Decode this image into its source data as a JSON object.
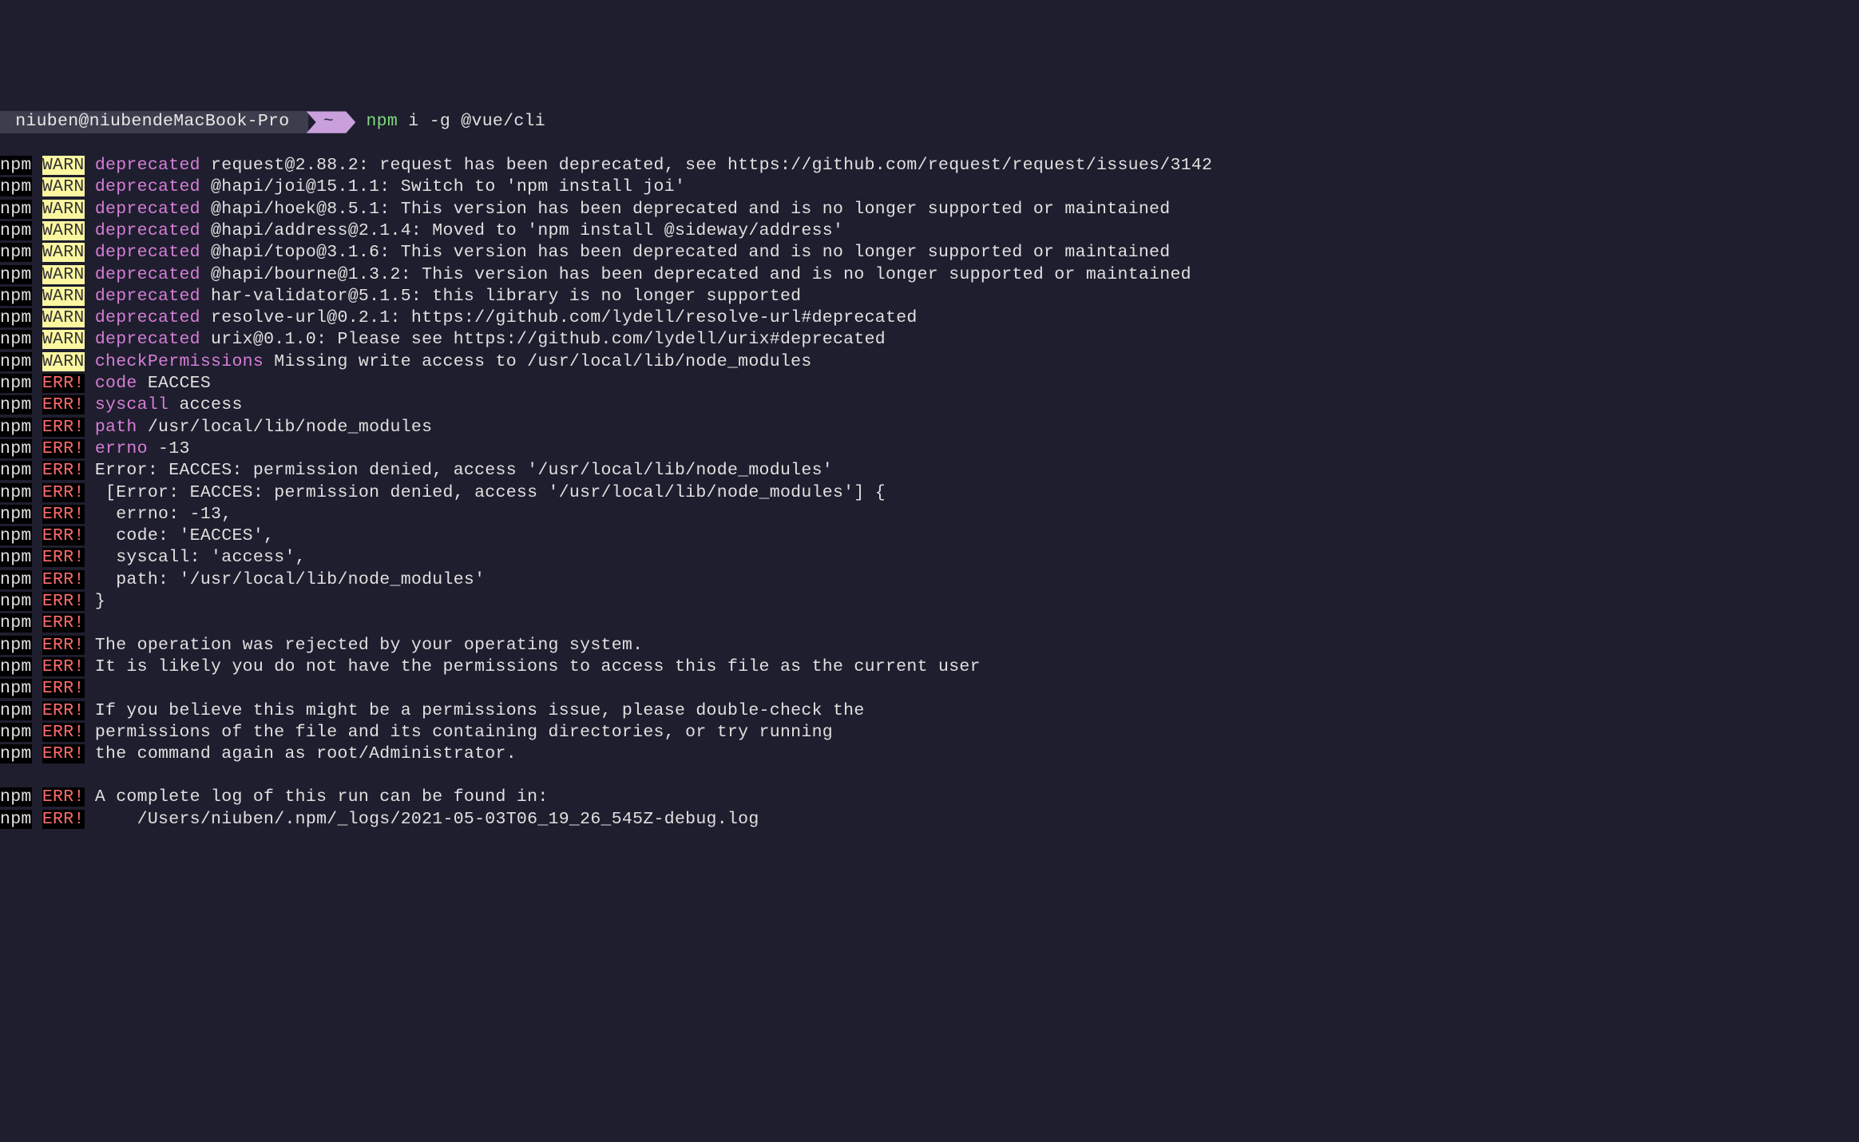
{
  "prompt": {
    "user": " niuben@niubendeMacBook-Pro ",
    "tilde": " ~ ",
    "command_npm": " npm",
    "command_args": " i -g @vue/cli"
  },
  "lines": [
    {
      "type": "warn",
      "kw": "deprecated",
      "rest": " request@2.88.2: request has been deprecated, see https://github.com/request/request/issues/3142"
    },
    {
      "type": "warn",
      "kw": "deprecated",
      "rest": " @hapi/joi@15.1.1: Switch to 'npm install joi'"
    },
    {
      "type": "warn",
      "kw": "deprecated",
      "rest": " @hapi/hoek@8.5.1: This version has been deprecated and is no longer supported or maintained"
    },
    {
      "type": "warn",
      "kw": "deprecated",
      "rest": " @hapi/address@2.1.4: Moved to 'npm install @sideway/address'"
    },
    {
      "type": "warn",
      "kw": "deprecated",
      "rest": " @hapi/topo@3.1.6: This version has been deprecated and is no longer supported or maintained"
    },
    {
      "type": "warn",
      "kw": "deprecated",
      "rest": " @hapi/bourne@1.3.2: This version has been deprecated and is no longer supported or maintained"
    },
    {
      "type": "warn",
      "kw": "deprecated",
      "rest": " har-validator@5.1.5: this library is no longer supported"
    },
    {
      "type": "warn",
      "kw": "deprecated",
      "rest": " resolve-url@0.2.1: https://github.com/lydell/resolve-url#deprecated"
    },
    {
      "type": "warn",
      "kw": "deprecated",
      "rest": " urix@0.1.0: Please see https://github.com/lydell/urix#deprecated"
    },
    {
      "type": "warn",
      "kw": "checkPermissions",
      "rest": " Missing write access to /usr/local/lib/node_modules"
    },
    {
      "type": "errkey",
      "kw": "code",
      "rest": " EACCES"
    },
    {
      "type": "errkey",
      "kw": "syscall",
      "rest": " access"
    },
    {
      "type": "errkey",
      "kw": "path",
      "rest": " /usr/local/lib/node_modules"
    },
    {
      "type": "errkey",
      "kw": "errno",
      "rest": " -13"
    },
    {
      "type": "err",
      "rest": " Error: EACCES: permission denied, access '/usr/local/lib/node_modules'"
    },
    {
      "type": "err",
      "rest": "  [Error: EACCES: permission denied, access '/usr/local/lib/node_modules'] {"
    },
    {
      "type": "err",
      "rest": "   errno: -13,"
    },
    {
      "type": "err",
      "rest": "   code: 'EACCES',"
    },
    {
      "type": "err",
      "rest": "   syscall: 'access',"
    },
    {
      "type": "err",
      "rest": "   path: '/usr/local/lib/node_modules'"
    },
    {
      "type": "err",
      "rest": " }"
    },
    {
      "type": "err",
      "rest": ""
    },
    {
      "type": "err",
      "rest": " The operation was rejected by your operating system."
    },
    {
      "type": "err",
      "rest": " It is likely you do not have the permissions to access this file as the current user"
    },
    {
      "type": "err",
      "rest": ""
    },
    {
      "type": "err",
      "rest": " If you believe this might be a permissions issue, please double-check the"
    },
    {
      "type": "err",
      "rest": " permissions of the file and its containing directories, or try running"
    },
    {
      "type": "err",
      "rest": " the command again as root/Administrator."
    },
    {
      "type": "blank"
    },
    {
      "type": "err",
      "rest": " A complete log of this run can be found in:"
    },
    {
      "type": "err",
      "rest": "     /Users/niuben/.npm/_logs/2021-05-03T06_19_26_545Z-debug.log"
    }
  ],
  "labels": {
    "npm": "npm",
    "warn": "WARN",
    "err": "ERR!"
  }
}
